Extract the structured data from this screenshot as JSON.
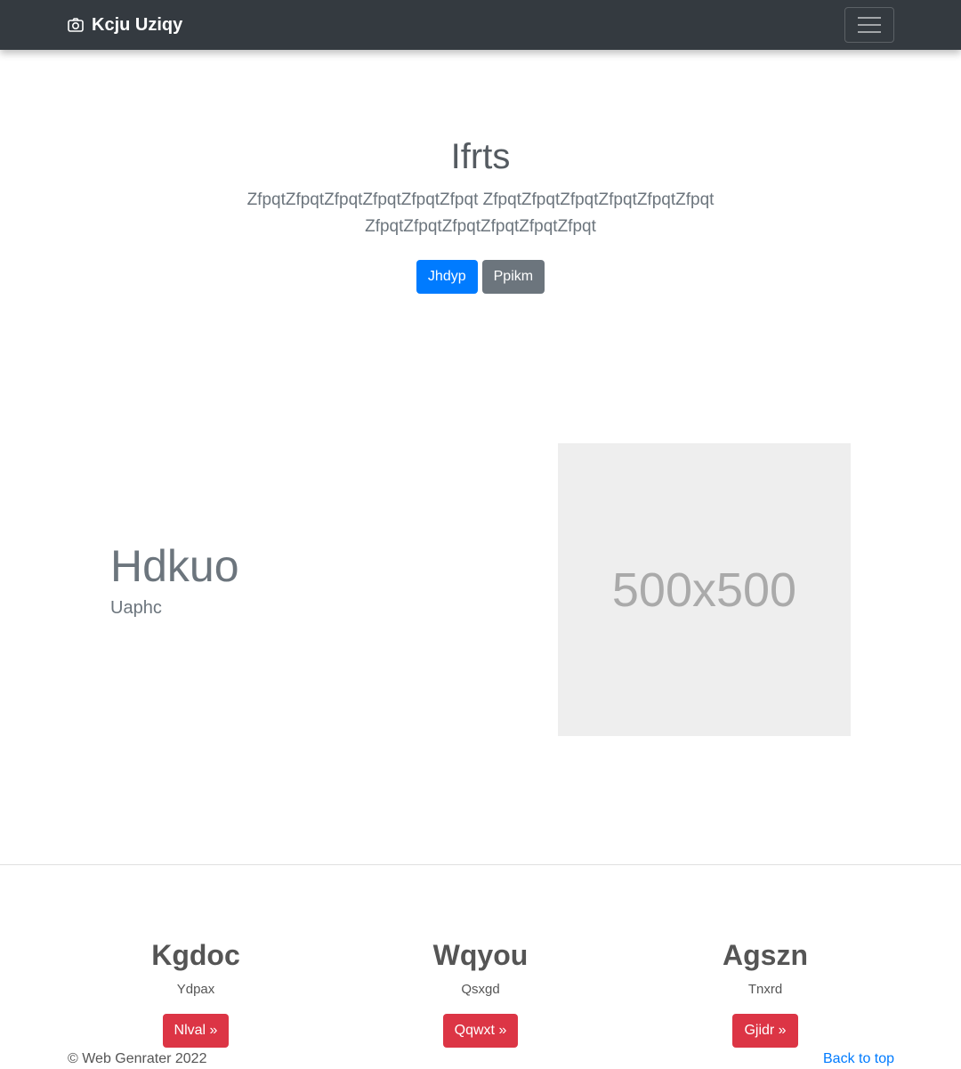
{
  "navbar": {
    "brand": "Kcju Uziqy",
    "brand_icon": "camera-icon",
    "toggler_icon": "hamburger-menu-icon",
    "background": "#343a40"
  },
  "hero": {
    "title": "Ifrts",
    "lead": "ZfpqtZfpqtZfpqtZfpqtZfpqtZfpqt ZfpqtZfpqtZfpqtZfpqtZfpqtZfpqt ZfpqtZfpqtZfpqtZfpqtZfpqtZfpqt",
    "primary_button": "Jhdyp",
    "secondary_button": "Ppikm"
  },
  "feature": {
    "heading": "Hdkuo",
    "subheading": "Uaphc",
    "image_label": "500x500"
  },
  "columns": [
    {
      "title": "Kgdoc",
      "text": "Ydpax",
      "button": "Nlval »"
    },
    {
      "title": "Wqyou",
      "text": "Qsxgd",
      "button": "Qqwxt »"
    },
    {
      "title": "Agszn",
      "text": "Tnxrd",
      "button": "Gjidr »"
    }
  ],
  "footer": {
    "copyright": "© Web Genrater 2022",
    "back_to_top": "Back to top"
  },
  "colors": {
    "primary": "#007bff",
    "secondary": "#6c757d",
    "danger": "#dc3545"
  }
}
